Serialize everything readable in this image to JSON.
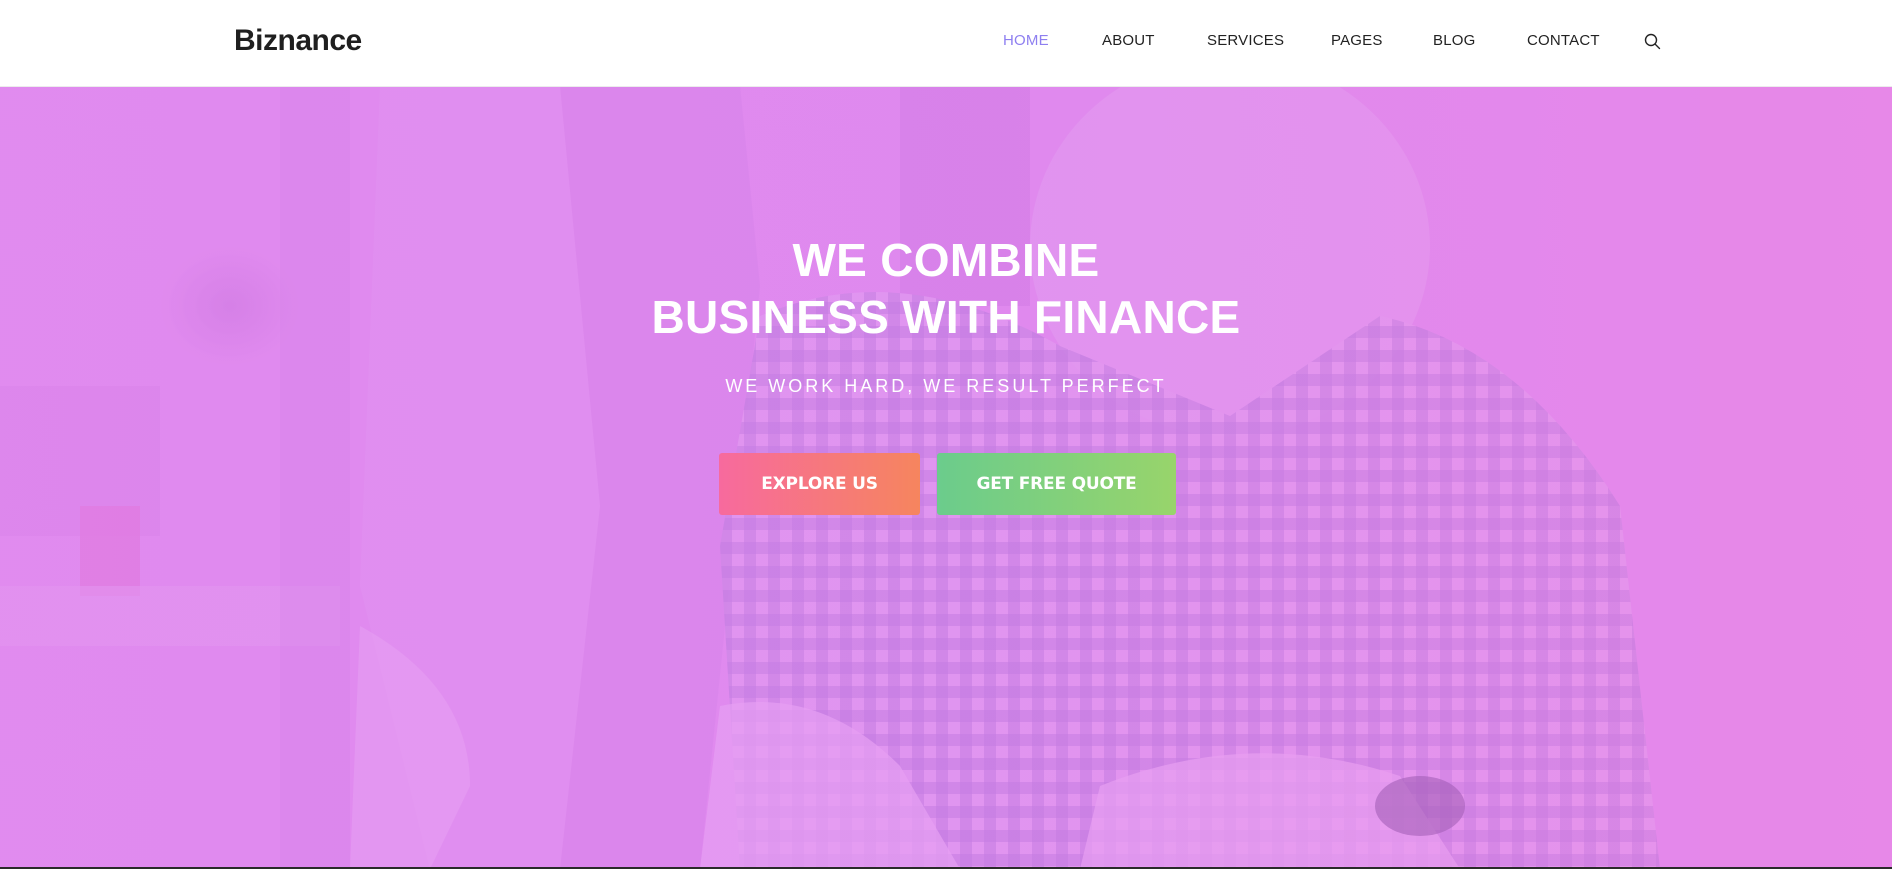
{
  "header": {
    "logo": "Biznance",
    "nav": [
      {
        "label": "HOME",
        "active": true
      },
      {
        "label": "ABOUT",
        "active": false
      },
      {
        "label": "SERVICES",
        "active": false
      },
      {
        "label": "PAGES",
        "active": false
      },
      {
        "label": "BLOG",
        "active": false
      },
      {
        "label": "CONTACT",
        "active": false
      }
    ],
    "search_icon": "search-icon"
  },
  "hero": {
    "title_line1": "WE COMBINE",
    "title_line2": "BUSINESS WITH FINANCE",
    "subtitle": "WE WORK HARD, WE RESULT PERFECT",
    "explore_button": "EXPLORE US",
    "quote_button": "GET FREE QUOTE"
  },
  "colors": {
    "nav_active": "#8e7ff0",
    "hero_overlay": "#e48df0",
    "explore_gradient_start": "#f76a9e",
    "explore_gradient_end": "#f6855e",
    "quote_gradient_start": "#6bcc8c",
    "quote_gradient_end": "#98d46b"
  }
}
